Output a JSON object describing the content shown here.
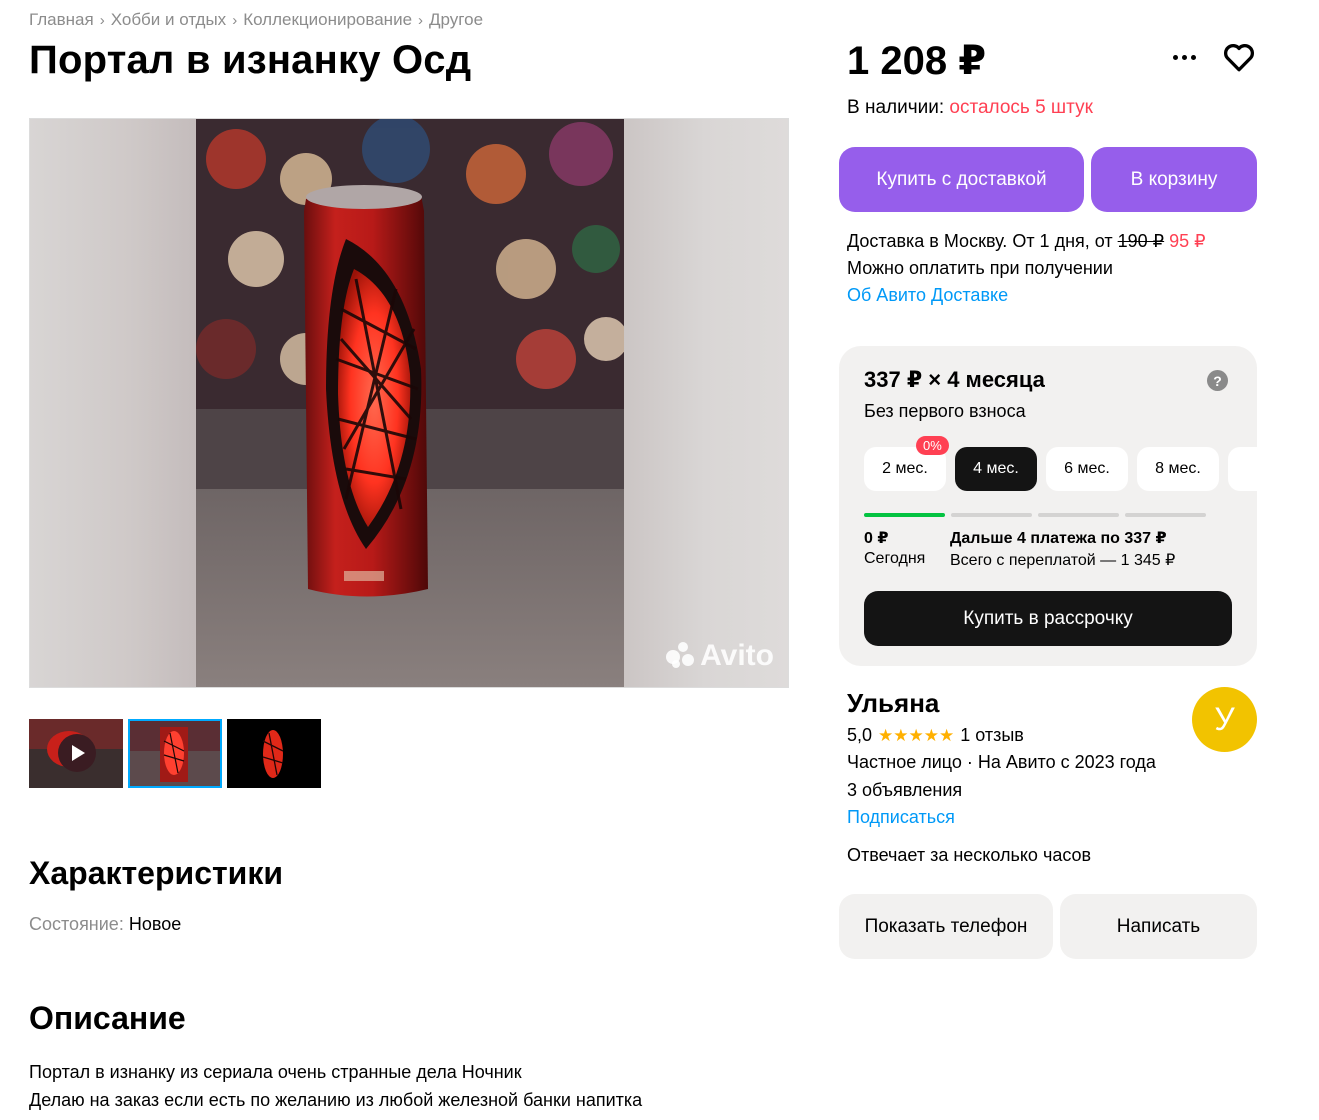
{
  "breadcrumbs": [
    "Главная",
    "Хобби и отдых",
    "Коллекционирование",
    "Другое"
  ],
  "breadcrumb_separator": "›",
  "title": "Портал в изнанку Осд",
  "gallery": {
    "watermark": "Avito",
    "thumbnails": [
      "video-thumbnail",
      "photo-1",
      "photo-2"
    ],
    "selected_index": 1
  },
  "characteristics": {
    "heading": "Характеристики",
    "condition_label": "Состояние:",
    "condition_value": "Новое"
  },
  "description": {
    "heading": "Описание",
    "lines": [
      "Портал в изнанку из сериала очень странные дела Ночник",
      "Делаю на заказ если есть по желанию из любой железной банки напитка"
    ]
  },
  "price": "1 208 ₽",
  "stock": {
    "label": "В наличии:",
    "value": "осталось 5 штук"
  },
  "buttons": {
    "buy_delivery": "Купить с доставкой",
    "to_cart": "В корзину",
    "buy_installment": "Купить в рассрочку",
    "show_phone": "Показать телефон",
    "write": "Написать",
    "more_icon": "more-icon",
    "favorite_icon": "heart-icon"
  },
  "delivery": {
    "line1_prefix": "Доставка в Москву. От 1 дня, от",
    "old_price": "190 ₽",
    "new_price": "95 ₽",
    "line2": "Можно оплатить при получении",
    "link": "Об Авито Доставке"
  },
  "installment": {
    "heading": "337 ₽ × 4 месяца",
    "sub": "Без первого взноса",
    "badge": "0%",
    "help": "?",
    "terms": [
      "2 мес.",
      "4 мес.",
      "6 мес.",
      "8 мес."
    ],
    "active_term": 1,
    "today_sum": "0 ₽",
    "today_label": "Сегодня",
    "next_sum": "Дальше 4 платежа по 337 ₽",
    "total": "Всего с переплатой — 1 345 ₽",
    "progress_segments": 5,
    "progress_filled": 1
  },
  "seller": {
    "name": "Ульяна",
    "avatar_letter": "У",
    "rating": "5,0",
    "stars": "★★★★★",
    "reviews": "1 отзыв",
    "type": "Частное лицо · На Авито с 2023 года",
    "ads": "3 объявления",
    "subscribe": "Подписаться",
    "responds": "Отвечает за несколько часов"
  },
  "colors": {
    "accent_purple": "#965eeb",
    "alert_red": "#ff4053",
    "link_blue": "#0099f7",
    "progress_green": "#04c341",
    "avatar_yellow": "#f2c300"
  }
}
